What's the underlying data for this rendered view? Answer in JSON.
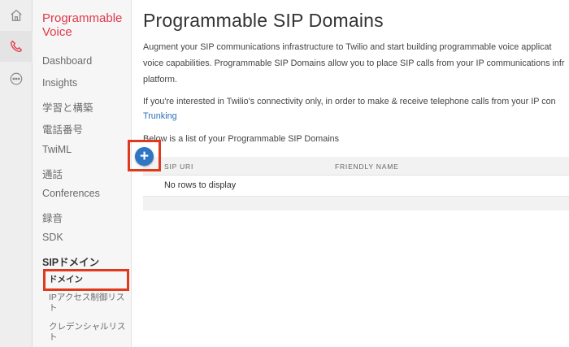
{
  "rail": {
    "icons": [
      "home-icon",
      "phone-icon",
      "more-icon"
    ]
  },
  "sidebar": {
    "product_title": "Programmable Voice",
    "items": [
      {
        "label": "Dashboard"
      },
      {
        "label": "Insights"
      },
      {
        "label": "学習と構築"
      },
      {
        "label": "電話番号"
      },
      {
        "label": "TwiML"
      },
      {
        "label": "通話"
      },
      {
        "label": "Conferences"
      },
      {
        "label": "録音"
      },
      {
        "label": "SDK"
      },
      {
        "label": "SIPドメイン"
      }
    ],
    "subitems": [
      {
        "label": "ドメイン"
      },
      {
        "label": "IPアクセス制御リスト"
      },
      {
        "label": "クレデンシャルリスト"
      }
    ]
  },
  "main": {
    "title": "Programmable SIP Domains",
    "intro_line1": "Augment your SIP communications infrastructure to Twilio and start building programmable voice applicat",
    "intro_line2": "voice capabilities. Programmable SIP Domains allow you to place SIP calls from your IP communications infr",
    "intro_line3": "platform.",
    "connectivity_line1": "If you're interested in Twilio's connectivity only, in order to make & receive telephone calls from your IP con",
    "connectivity_link": "Trunking",
    "list_intro": "Below is a list of your Programmable SIP Domains",
    "add_button_label": "+",
    "table": {
      "columns": [
        "SIP URI",
        "FRIENDLY NAME"
      ],
      "empty_text": "No rows to display"
    }
  },
  "colors": {
    "brand_red": "#e0394b",
    "link_blue": "#2b6fb5",
    "annotation_red": "#e0391e",
    "add_button_blue": "#2e76c4"
  }
}
